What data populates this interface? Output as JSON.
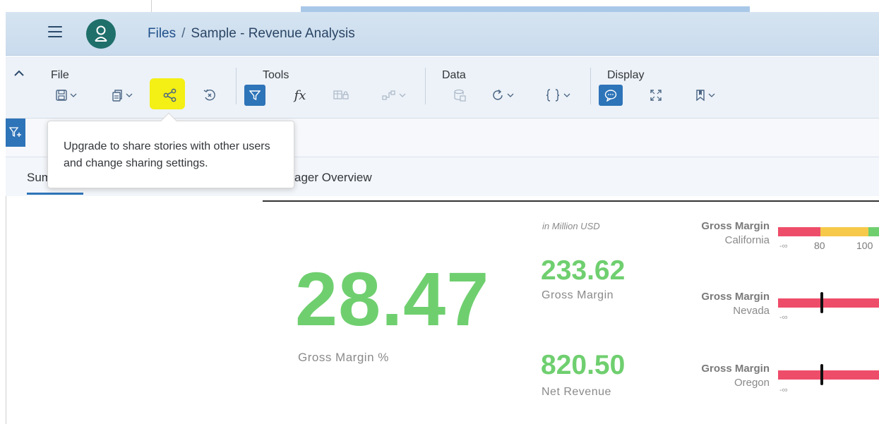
{
  "shell": {
    "breadcrumb_root": "Files",
    "breadcrumb_separator": "/",
    "breadcrumb_current": "Sample - Revenue Analysis",
    "menu_icon": "hamburger-icon",
    "avatar_icon": "user-icon",
    "accent_color": "#2e74b8"
  },
  "toolbar": {
    "groups": [
      {
        "label": "File",
        "icons": [
          "save-icon",
          "copy-icon",
          "share-icon",
          "revert-icon"
        ]
      },
      {
        "label": "Tools",
        "icons": [
          "filter-icon",
          "formula-icon",
          "table-icon",
          "link-icon"
        ]
      },
      {
        "label": "Data",
        "icons": [
          "data-source-icon",
          "refresh-icon",
          "code-icon"
        ]
      },
      {
        "label": "Display",
        "icons": [
          "comment-icon",
          "fullscreen-icon",
          "bookmark-icon"
        ]
      }
    ],
    "collapse_icon": "chevron-up-icon"
  },
  "tooltip": {
    "text": "Upgrade to share stories with other users and change sharing settings."
  },
  "tabs": [
    {
      "label": "Sum"
    },
    {
      "label": "ager Overview"
    }
  ],
  "kpi": {
    "main_value": "28.47",
    "main_label": "Gross Margin %",
    "unit_note": "in Million USD",
    "gross_margin_value": "233.62",
    "gross_margin_label": "Gross Margin",
    "net_revenue_value": "820.50",
    "net_revenue_label": "Net Revenue",
    "value_color": "#6fcf6f"
  },
  "bullets": [
    {
      "title": "Gross Margin",
      "region": "California",
      "min_label": "-∞",
      "ticks": [
        "80",
        "100"
      ]
    },
    {
      "title": "Gross Margin",
      "region": "Nevada",
      "min_label": "-∞"
    },
    {
      "title": "Gross Margin",
      "region": "Oregon",
      "min_label": "-∞"
    }
  ],
  "colors": {
    "bar_red": "#ee4d6a",
    "bar_yellow": "#f6c94a",
    "bar_green": "#6fcf6f",
    "highlight": "#f4ef00"
  }
}
